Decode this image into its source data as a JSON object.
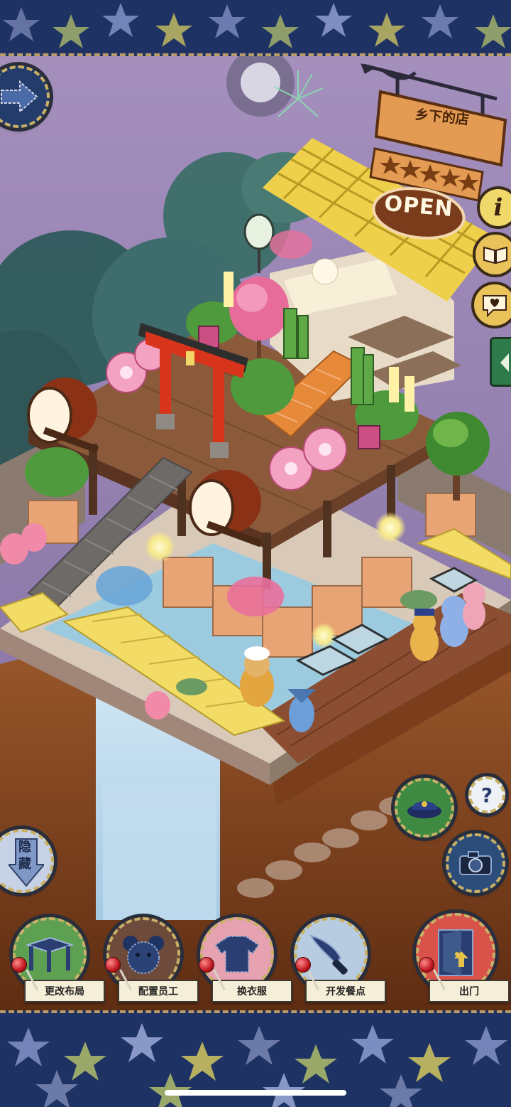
{
  "shop": {
    "name": "乡下的店",
    "status": "OPEN",
    "rating_stars": 5
  },
  "side_buttons": {
    "info_icon": "info-icon",
    "book_icon": "recipe-book-icon",
    "heart_icon": "heart-speech-icon"
  },
  "hide_button": {
    "label": "隐藏"
  },
  "corner_buttons": {
    "help": "?"
  },
  "bottom_menu": [
    {
      "label": "更改布局",
      "icon": "table-icon"
    },
    {
      "label": "配置员工",
      "icon": "bear-head-icon"
    },
    {
      "label": "换衣服",
      "icon": "shirt-icon"
    },
    {
      "label": "开发餐点",
      "icon": "knife-icon"
    },
    {
      "label": "出门",
      "icon": "door-icon"
    }
  ],
  "colors": {
    "sky": "#9a84b4",
    "band": "#1e3364",
    "roof": "#f0d24a",
    "wood": "#8b5a3a",
    "water": "#a9d6ec",
    "torii": "#d8341c"
  }
}
